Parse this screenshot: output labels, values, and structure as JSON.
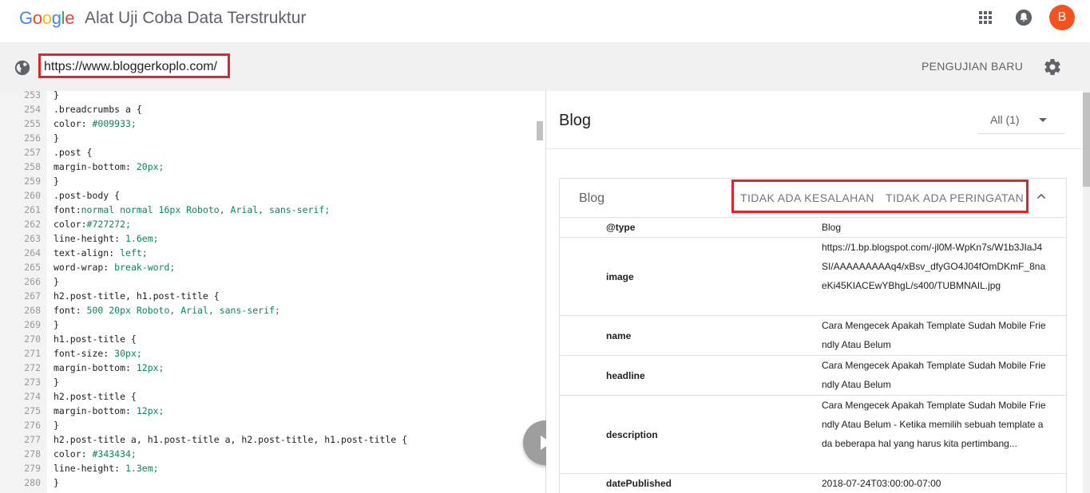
{
  "header": {
    "logo": "Google",
    "title": "Alat Uji Coba Data Terstruktur",
    "avatar_letter": "B",
    "apps_icon": "apps-grid-icon",
    "notification_icon": "bell-icon"
  },
  "toolbar": {
    "url_value": "https://www.bloggerkoplo.com/",
    "new_test_label": "PENGUJIAN BARU",
    "globe_icon": "globe-icon",
    "settings_icon": "gear-icon"
  },
  "code": {
    "lines": [
      {
        "n": "253",
        "t": "}"
      },
      {
        "n": "254",
        "t": ".breadcrumbs a {"
      },
      {
        "n": "255",
        "t": "color: #009933;"
      },
      {
        "n": "256",
        "t": "}"
      },
      {
        "n": "257",
        "t": ".post {"
      },
      {
        "n": "258",
        "t": "margin-bottom: 20px;"
      },
      {
        "n": "259",
        "t": "}"
      },
      {
        "n": "260",
        "t": ".post-body {"
      },
      {
        "n": "261",
        "t": "font:normal normal 16px Roboto, Arial, sans-serif;"
      },
      {
        "n": "262",
        "t": "color:#727272;"
      },
      {
        "n": "263",
        "t": "line-height: 1.6em;"
      },
      {
        "n": "264",
        "t": "text-align: left;"
      },
      {
        "n": "265",
        "t": "word-wrap: break-word;"
      },
      {
        "n": "266",
        "t": "}"
      },
      {
        "n": "267",
        "t": "h2.post-title, h1.post-title {"
      },
      {
        "n": "268",
        "t": "font: 500 20px Roboto, Arial, sans-serif;"
      },
      {
        "n": "269",
        "t": "}"
      },
      {
        "n": "270",
        "t": "h1.post-title {"
      },
      {
        "n": "271",
        "t": "font-size: 30px;"
      },
      {
        "n": "272",
        "t": "margin-bottom: 12px;"
      },
      {
        "n": "273",
        "t": "}"
      },
      {
        "n": "274",
        "t": "h2.post-title {"
      },
      {
        "n": "275",
        "t": "margin-bottom: 12px;"
      },
      {
        "n": "276",
        "t": "}"
      },
      {
        "n": "277",
        "t": "h2.post-title a, h1.post-title a, h2.post-title, h1.post-title {"
      },
      {
        "n": "278",
        "t": "color: #343434;"
      },
      {
        "n": "279",
        "t": "line-height: 1.3em;"
      },
      {
        "n": "280",
        "t": "}"
      }
    ]
  },
  "result": {
    "title": "Blog",
    "filter_label": "All (1)",
    "card": {
      "title": "Blog",
      "errors_label": "TIDAK ADA KESALAHAN",
      "warnings_label": "TIDAK ADA PERINGATAN",
      "rows": [
        {
          "key": "@type",
          "value": "Blog"
        },
        {
          "key": "image",
          "value": "https://1.bp.blogspot.com/-jl0M-WpKn7s/W1b3JIaJ4SI/AAAAAAAAAq4/xBsv_dfyGO4J04fOmDKmF_8naeKi45KIACEwYBhgL/s400/TUBMNAIL.jpg"
        },
        {
          "key": "name",
          "value": "Cara Mengecek Apakah Template Sudah Mobile Friendly Atau Belum"
        },
        {
          "key": "headline",
          "value": "Cara Mengecek Apakah Template Sudah Mobile Friendly Atau Belum"
        },
        {
          "key": "description",
          "value": "Cara Mengecek Apakah Template Sudah Mobile Friendly Atau Belum - Ketika memilih sebuah template ada beberapa hal yang harus kita pertimbang..."
        },
        {
          "key": "datePublished",
          "value": "2018-07-24T03:00:00-07:00"
        }
      ]
    }
  },
  "colors": {
    "highlight": "#e0242b",
    "avatar": "#f4511e",
    "css_value": "#098658",
    "css_keyword": "#0000ff"
  }
}
